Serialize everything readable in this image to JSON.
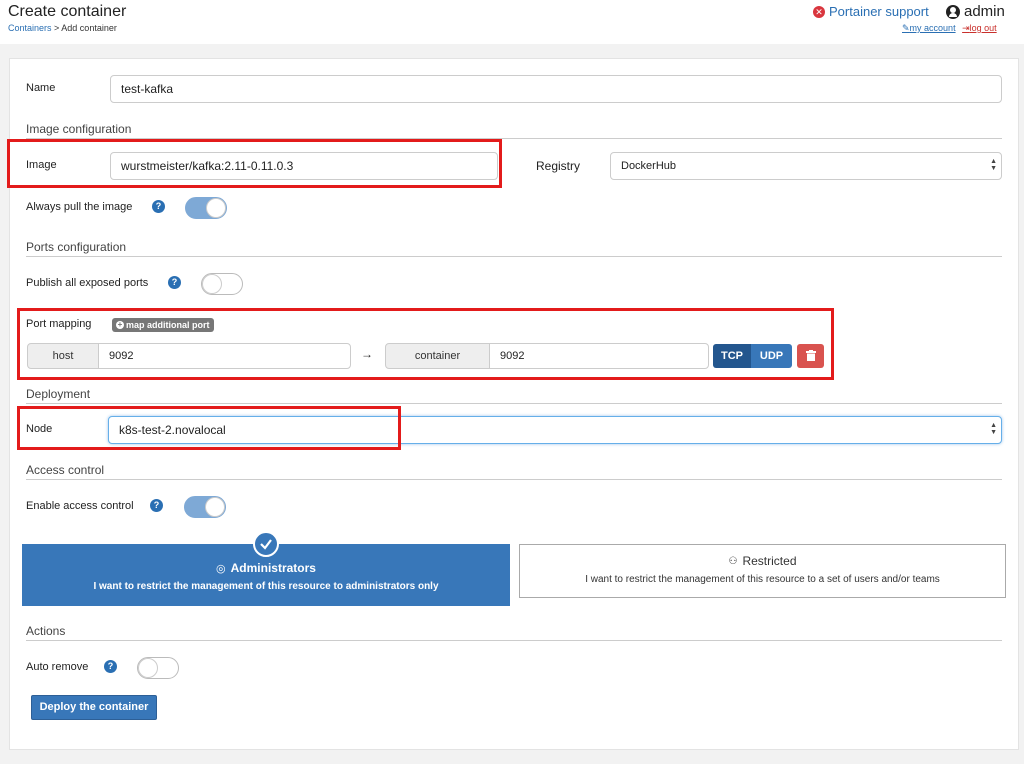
{
  "header": {
    "title": "Create container",
    "breadcrumb_link": "Containers",
    "breadcrumb_sep": " > ",
    "breadcrumb_current": "Add container",
    "support_label": "Portainer support",
    "user_name": "admin",
    "my_account": "my account",
    "log_out": "log out"
  },
  "form": {
    "name_label": "Name",
    "name_value": "test-kafka",
    "image_section": "Image configuration",
    "image_label": "Image",
    "image_value": "wurstmeister/kafka:2.11-0.11.0.3",
    "registry_label": "Registry",
    "registry_value": "DockerHub",
    "always_pull_label": "Always pull the image",
    "always_pull": true,
    "ports_section": "Ports configuration",
    "publish_all_label": "Publish all exposed ports",
    "publish_all": false,
    "port_mapping_label": "Port mapping",
    "map_port_button": "map additional port",
    "host_addon": "host",
    "host_port": "9092",
    "arrow": "→",
    "container_addon": "container",
    "container_port": "9092",
    "tcp": "TCP",
    "udp": "UDP",
    "deployment_section": "Deployment",
    "node_label": "Node",
    "node_value": "k8s-test-2.novalocal",
    "access_section": "Access control",
    "enable_access_label": "Enable access control",
    "enable_access": true,
    "admin_title": "Administrators",
    "admin_desc": "I want to restrict the management of this resource to administrators only",
    "restricted_title": "Restricted",
    "restricted_desc": "I want to restrict the management of this resource to a set of users and/or teams",
    "actions_section": "Actions",
    "auto_remove_label": "Auto remove",
    "auto_remove": false,
    "deploy_button": "Deploy the container"
  },
  "colors": {
    "primary": "#3877b9",
    "danger": "#d9534f",
    "highlight": "#e31b1b"
  }
}
